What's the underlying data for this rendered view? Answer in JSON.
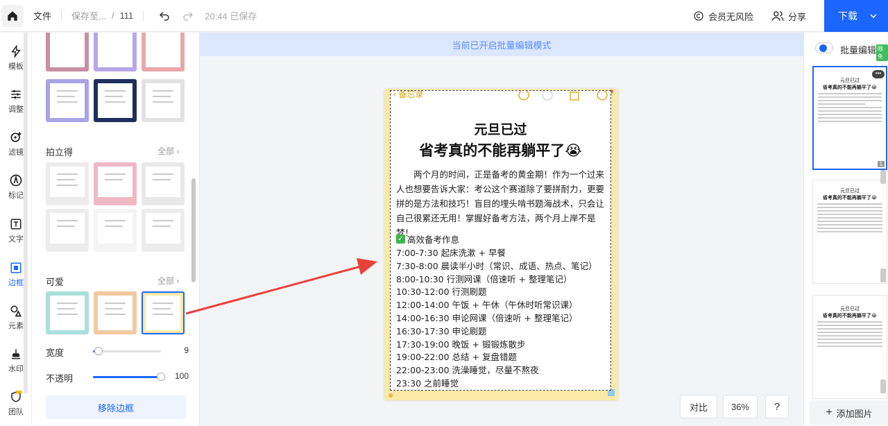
{
  "topbar": {
    "file_menu": "文件",
    "save_location": "保存至...",
    "path_sep": "/",
    "doc_name": "111",
    "save_status": "20:44 已保存",
    "member": "会员无风险",
    "share": "分享",
    "download": "下载"
  },
  "rail": [
    {
      "label": "模板",
      "icon": "template-icon"
    },
    {
      "label": "调整",
      "icon": "adjust-icon"
    },
    {
      "label": "滤镜",
      "icon": "filter-icon"
    },
    {
      "label": "标记",
      "icon": "marker-icon"
    },
    {
      "label": "文字",
      "icon": "text-icon"
    },
    {
      "label": "边框",
      "icon": "border-icon",
      "active": true
    },
    {
      "label": "元素",
      "icon": "elements-icon"
    },
    {
      "label": "水印",
      "icon": "watermark-icon"
    },
    {
      "label": "团队",
      "icon": "team-icon"
    }
  ],
  "panel": {
    "section_polaroid": "拍立得",
    "section_cute": "可爱",
    "all_label": "全部",
    "width_label": "宽度",
    "width_value": "9",
    "width_fraction": 0.08,
    "opacity_label": "不透明",
    "opacity_value": "100",
    "opacity_fraction": 1.0,
    "remove_border": "移除边框"
  },
  "center": {
    "banner": "当前已开启批量编辑模式",
    "compare": "对比",
    "zoom": "36%",
    "help": "?"
  },
  "document": {
    "back_label": "备忘录",
    "title1": "元旦已过",
    "title2": "省考真的不能再躺平了😭",
    "paragraph": "两个月的时间，正是备考的黄金期！作为一个过来人也想要告诉大家：考公这个赛道除了要拼耐力，更要拼的是方法和技巧！盲目的埋头啃书题海战术，只会让自己很累还无用！掌握好备考方法，两个月上岸不是梦！",
    "schedule_title": "高效备考作息",
    "schedule": [
      "7:00-7:30  起床洗漱 + 早餐",
      "7:30-8:00  晨读半小时（常识、成语、热点、笔记）",
      "8:00-10:30  行测网课（倍速听 + 整理笔记）",
      "10:30-12:00  行测刷题",
      "12:00-14:00  午饭 + 午休（午休时听常识课）",
      "14:00-16:30  申论网课（倍速听 + 整理笔记）",
      "16:30-17:30  申论刷题",
      "17:30-19:00  晚饭 + 锻锻炼散步",
      "19:00-22:00  总结 + 复盘错题",
      "22:00-23:00  洗澡睡觉，尽量不熬夜",
      "23:30  之前睡觉"
    ]
  },
  "right": {
    "batch_edit": "批量编辑",
    "free_badge": "限免",
    "page1_number": "1",
    "add_image": "添加图片",
    "thumb_title1": "元旦已过",
    "thumb_title2": "省考真的不能再躺平了😭"
  },
  "colors": {
    "accent": "#1a66ff",
    "banner_bg": "#dbe7ff",
    "frame_yellow": "#fbe9a7",
    "arrow_red": "#e8413a"
  }
}
